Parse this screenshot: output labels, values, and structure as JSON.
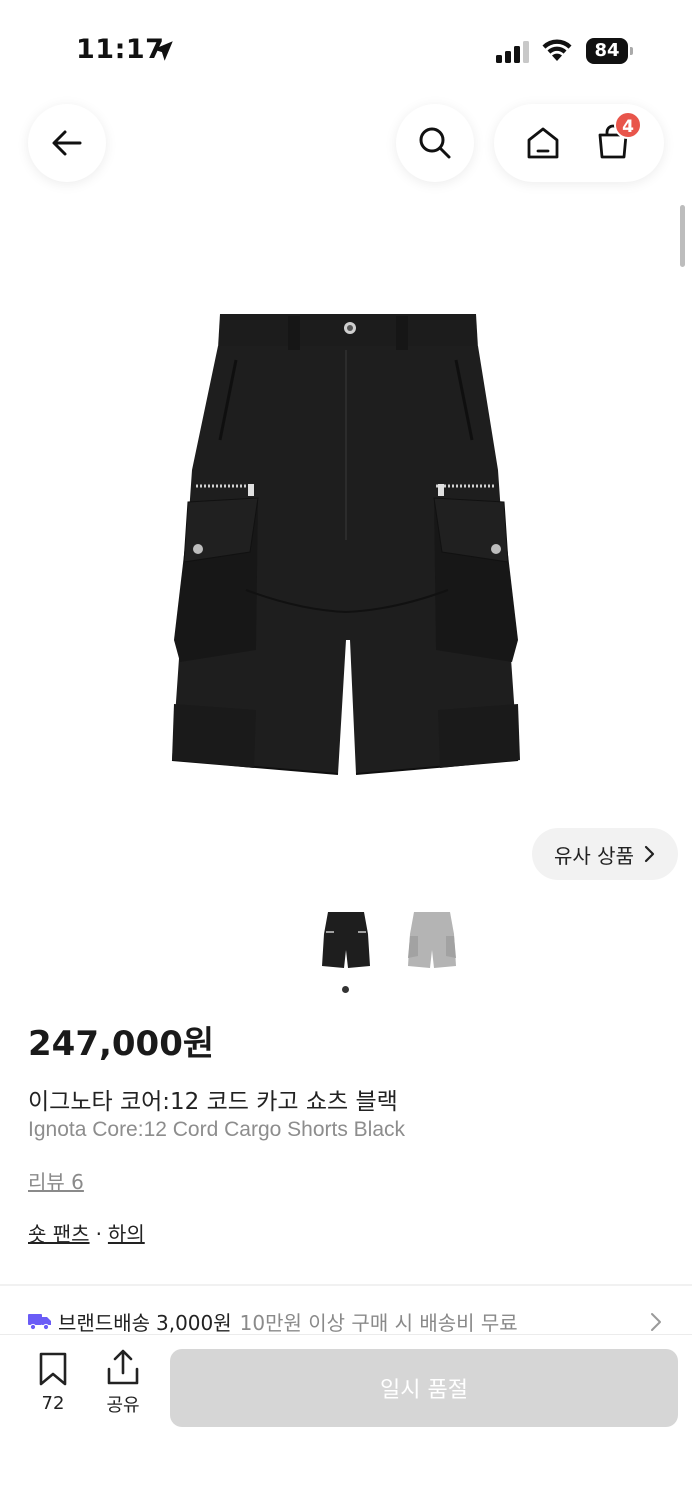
{
  "status_bar": {
    "time": "11:17",
    "battery": "84"
  },
  "nav": {
    "cart_count": "4"
  },
  "similar_button": {
    "label": "유사 상품"
  },
  "gallery": {
    "current_index": 1,
    "total": 2
  },
  "product": {
    "price": "247,000원",
    "name_ko": "이그노타 코어:12 코드 카고 쇼츠 블랙",
    "name_en": "Ignota Core:12 Cord Cargo Shorts Black",
    "review_link": "리뷰 6",
    "category_1": "숏 팬츠",
    "category_sep": "·",
    "category_2": "하의"
  },
  "shipping": {
    "label": "브랜드배송",
    "price": "3,000원",
    "note": "10만원 이상 구매 시 배송비 무료"
  },
  "bottom_bar": {
    "bookmark_count": "72",
    "share_label": "공유",
    "buy_label": "일시 품절"
  },
  "colors": {
    "badge": "#e8554b",
    "truck": "#6a5cf6",
    "soldout_button": "#d6d6d6"
  }
}
